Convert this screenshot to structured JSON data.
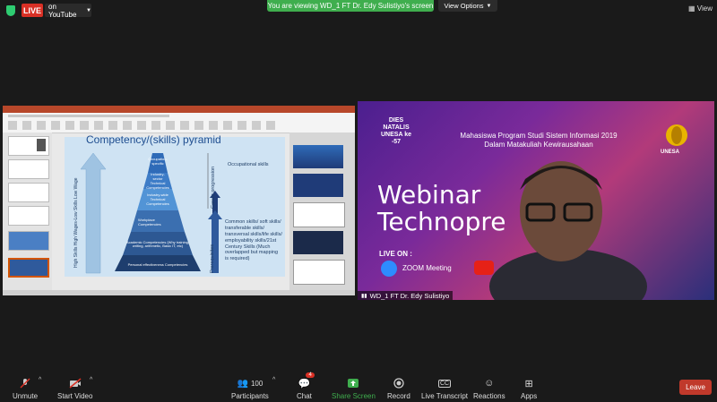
{
  "top_bar": {
    "live_label": "LIVE",
    "youtube_label": "on YouTube",
    "share_banner": "You are viewing WD_1 FT Dr. Edy Sulistiyo's screen",
    "view_options": "View Options",
    "view_label": "View"
  },
  "slide": {
    "title": "Competency/(skills) pyramid",
    "tiers": [
      "Personal effectiveness Competencies",
      "Academic Competencies (Why training, writing, arithmetic, Basic IT, etc)",
      "Workplace Competencies",
      "Industry-wide Technical Competencies",
      "Industry-sector Technical Competencies",
      "Occupation-specific"
    ],
    "left_arrow_text": "High Skills High Wages-Low Skills Low Wage",
    "right_arrow_text": "Career progression",
    "prerequisites": "Prerequisites",
    "occupational": "Occupational skills",
    "common": "Common skills/ soft skills/ transferable skills/ transversal skills/life skills/ employability skills/21st Century Skills (Much overlapped but mapping is required)"
  },
  "webinar": {
    "dies_natalis": "DIES NATALIS UNESA ke -57",
    "heading_line1": "Mahasiswa Program Studi Sistem Informasi 2019",
    "heading_line2": "Dalam Matakuliah Kewirausahaan",
    "unesa": "UNESA",
    "webinar_title": "Webinar",
    "webinar_sub": "Technopre",
    "live_on": "LIVE ON :",
    "zoom": "ZOOM Meeting",
    "speaker_label": "WD_1 FT Dr. Edy Sulistiyo"
  },
  "toolbar": {
    "unmute": "Unmute",
    "start_video": "Start Video",
    "participants": "Participants",
    "participant_count": "100",
    "chat": "Chat",
    "chat_badge": "4",
    "share_screen": "Share Screen",
    "record": "Record",
    "live_transcript": "Live Transcript",
    "reactions": "Reactions",
    "apps": "Apps",
    "leave": "Leave"
  },
  "colors": {
    "share_green": "#3fae4e",
    "live_red": "#d93025",
    "leave_red": "#c0392b"
  }
}
